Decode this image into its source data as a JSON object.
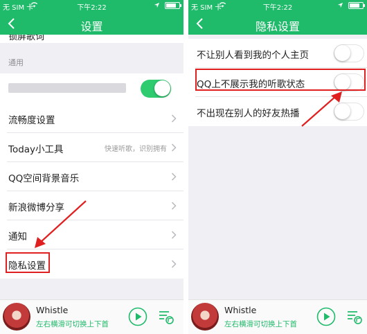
{
  "colors": {
    "accent": "#1fba6a",
    "highlight": "#e02020"
  },
  "left": {
    "status": {
      "carrier": "无 SIM 卡",
      "time": "下午2:22"
    },
    "title": "设置",
    "back_icon": "chevron-left-icon",
    "partial_row_label": "锁屏歌词",
    "section_label": "通用",
    "rows": [
      {
        "label": "流畅度设置",
        "sub": ""
      },
      {
        "label": "Today小工具",
        "sub": "快速听歌，识别拥有"
      },
      {
        "label": "QQ空间背景音乐",
        "sub": ""
      },
      {
        "label": "新浪微博分享",
        "sub": ""
      },
      {
        "label": "通知",
        "sub": ""
      },
      {
        "label": "隐私设置",
        "sub": ""
      }
    ]
  },
  "right": {
    "status": {
      "carrier": "无 SIM 卡",
      "time": "下午2:22"
    },
    "title": "隐私设置",
    "back_icon": "chevron-left-icon",
    "rows": [
      {
        "label": "不让别人看到我的个人主页",
        "on": false
      },
      {
        "label": "QQ上不展示我的听歌状态",
        "on": false
      },
      {
        "label": "不出现在别人的好友热播",
        "on": false
      }
    ]
  },
  "player": {
    "song": "Whistle",
    "hint": "左右横滑可切换上下首",
    "play_icon": "play-icon",
    "playlist_icon": "playlist-icon"
  }
}
